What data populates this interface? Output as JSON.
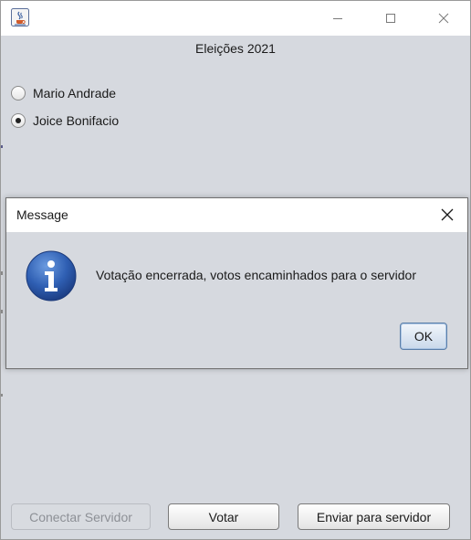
{
  "window": {
    "title": "Eleições 2021",
    "icon": "java-cup-icon",
    "controls": {
      "minimize": "minimize-icon",
      "maximize": "maximize-icon",
      "close": "close-icon"
    }
  },
  "candidates": [
    {
      "label": "Mario Andrade",
      "selected": false
    },
    {
      "label": "Joice Bonifacio",
      "selected": true
    }
  ],
  "dialog": {
    "title": "Message",
    "message": "Votação encerrada, votos encaminhados para o servidor",
    "icon": "info-icon",
    "ok_label": "OK"
  },
  "buttons": {
    "connect_label": "Conectar Servidor",
    "connect_enabled": false,
    "vote_label": "Votar",
    "send_label": "Enviar para servidor"
  },
  "colors": {
    "window_bg": "#d6d9df",
    "titlebar_bg": "#ffffff",
    "info_icon_blue": "#2f5fb3",
    "ok_focus_border": "#5b7fa9"
  }
}
